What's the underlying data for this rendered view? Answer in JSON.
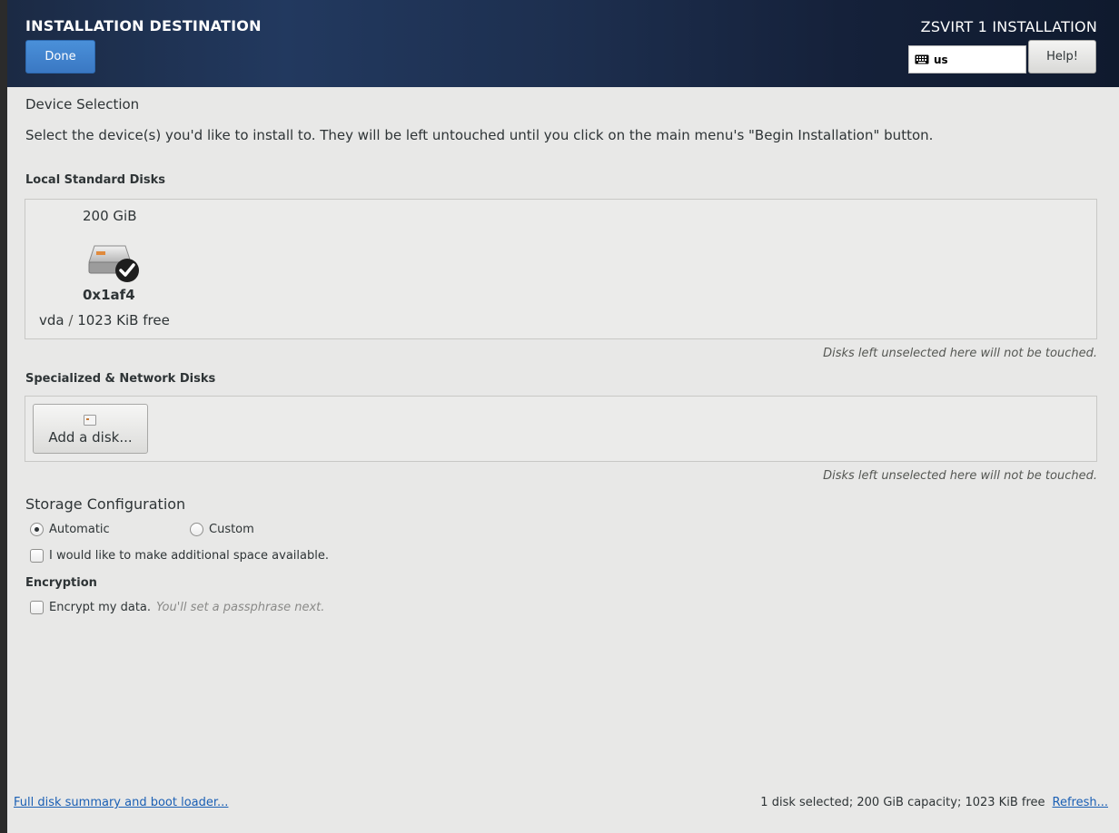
{
  "header": {
    "title": "INSTALLATION DESTINATION",
    "product": "ZSVIRT 1 INSTALLATION",
    "done_label": "Done",
    "keyboard_layout": "us",
    "help_label": "Help!"
  },
  "device_selection": {
    "heading": "Device Selection",
    "description": "Select the device(s) you'd like to install to.  They will be left untouched until you click on the main menu's \"Begin Installation\" button."
  },
  "local_disks": {
    "heading": "Local Standard Disks",
    "disks": [
      {
        "size": "200 GiB",
        "name": "0x1af4",
        "device": "vda",
        "separator": "/",
        "free": "1023 KiB free",
        "selected": true,
        "icon": "hard-disk-icon"
      }
    ],
    "note": "Disks left unselected here will not be touched."
  },
  "network_disks": {
    "heading": "Specialized & Network Disks",
    "add_label": "Add a disk...",
    "note": "Disks left unselected here will not be touched."
  },
  "storage": {
    "heading": "Storage Configuration",
    "automatic_label": "Automatic",
    "custom_label": "Custom",
    "selected": "Automatic",
    "extra_space_label": "I would like to make additional space available."
  },
  "encryption": {
    "heading": "Encryption",
    "encrypt_label": "Encrypt my data.",
    "encrypt_hint": "You'll set a passphrase next."
  },
  "footer": {
    "summary_link": "Full disk summary and boot loader...",
    "status": "1 disk selected; 200 GiB capacity; 1023 KiB free",
    "refresh_link": "Refresh..."
  },
  "colors": {
    "header_bg": "#1d2f4f",
    "done_button": "#3a78c3",
    "link": "#1a5fb4",
    "content_bg": "#e8e8e7"
  }
}
